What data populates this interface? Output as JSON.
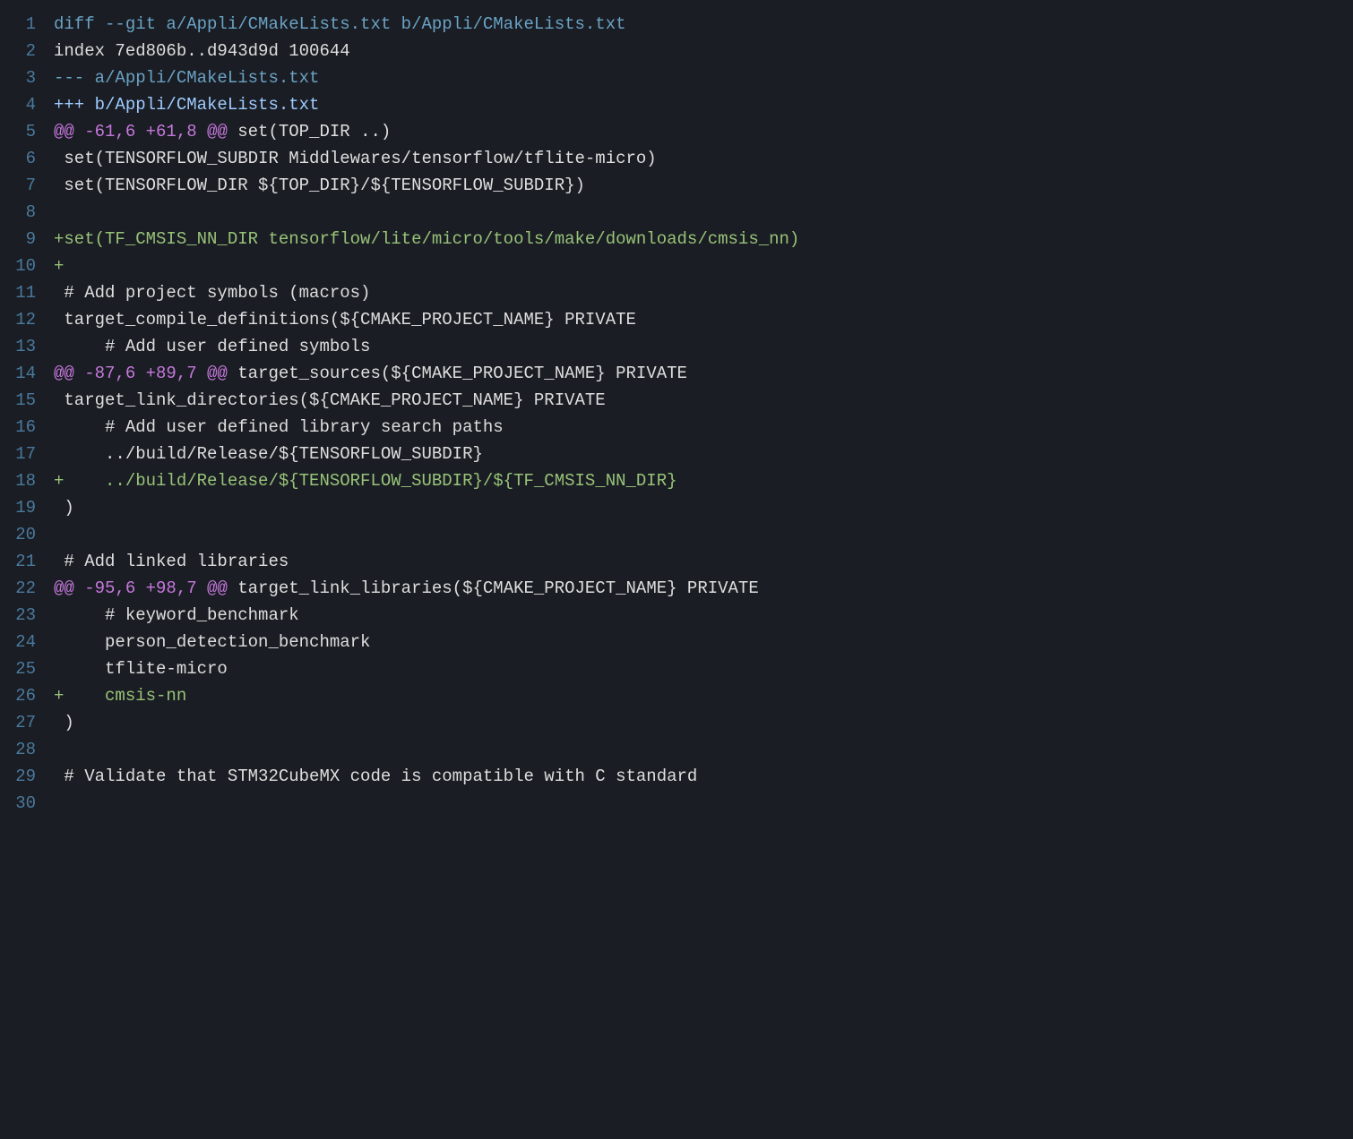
{
  "lines": [
    {
      "num": "1",
      "segments": [
        {
          "cls": "tok-diff-header",
          "text": "diff --git a/Appli/CMakeLists.txt b/Appli/CMakeLists.txt"
        }
      ]
    },
    {
      "num": "2",
      "segments": [
        {
          "cls": "tok-default",
          "text": "index 7ed806b..d943d9d 100644"
        }
      ]
    },
    {
      "num": "3",
      "segments": [
        {
          "cls": "tok-diff-minus",
          "text": "--- a/Appli/CMakeLists.txt"
        }
      ]
    },
    {
      "num": "4",
      "segments": [
        {
          "cls": "tok-diff-plus",
          "text": "+++ b/Appli/CMakeLists.txt"
        }
      ]
    },
    {
      "num": "5",
      "segments": [
        {
          "cls": "tok-hunk",
          "text": "@@ -61,6 +61,8 @@"
        },
        {
          "cls": "tok-context",
          "text": " set(TOP_DIR ..)"
        }
      ]
    },
    {
      "num": "6",
      "segments": [
        {
          "cls": "tok-default",
          "text": " set(TENSORFLOW_SUBDIR Middlewares/tensorflow/tflite-micro)"
        }
      ]
    },
    {
      "num": "7",
      "segments": [
        {
          "cls": "tok-default",
          "text": " set(TENSORFLOW_DIR ${TOP_DIR}/${TENSORFLOW_SUBDIR})"
        }
      ]
    },
    {
      "num": "8",
      "segments": [
        {
          "cls": "tok-default",
          "text": ""
        }
      ]
    },
    {
      "num": "9",
      "segments": [
        {
          "cls": "tok-added",
          "text": "+set(TF_CMSIS_NN_DIR tensorflow/lite/micro/tools/make/downloads/cmsis_nn)"
        }
      ]
    },
    {
      "num": "10",
      "segments": [
        {
          "cls": "tok-added",
          "text": "+"
        }
      ]
    },
    {
      "num": "11",
      "segments": [
        {
          "cls": "tok-default",
          "text": " # Add project symbols (macros)"
        }
      ]
    },
    {
      "num": "12",
      "segments": [
        {
          "cls": "tok-default",
          "text": " target_compile_definitions(${CMAKE_PROJECT_NAME} PRIVATE"
        }
      ]
    },
    {
      "num": "13",
      "segments": [
        {
          "cls": "tok-default",
          "text": "     # Add user defined symbols"
        }
      ]
    },
    {
      "num": "14",
      "segments": [
        {
          "cls": "tok-hunk",
          "text": "@@ -87,6 +89,7 @@"
        },
        {
          "cls": "tok-context",
          "text": " target_sources(${CMAKE_PROJECT_NAME} PRIVATE"
        }
      ]
    },
    {
      "num": "15",
      "segments": [
        {
          "cls": "tok-default",
          "text": " target_link_directories(${CMAKE_PROJECT_NAME} PRIVATE"
        }
      ]
    },
    {
      "num": "16",
      "segments": [
        {
          "cls": "tok-default",
          "text": "     # Add user defined library search paths"
        }
      ]
    },
    {
      "num": "17",
      "segments": [
        {
          "cls": "tok-default",
          "text": "     ../build/Release/${TENSORFLOW_SUBDIR}"
        }
      ]
    },
    {
      "num": "18",
      "segments": [
        {
          "cls": "tok-added",
          "text": "+    ../build/Release/${TENSORFLOW_SUBDIR}/${TF_CMSIS_NN_DIR}"
        }
      ]
    },
    {
      "num": "19",
      "segments": [
        {
          "cls": "tok-default",
          "text": " )"
        }
      ]
    },
    {
      "num": "20",
      "segments": [
        {
          "cls": "tok-default",
          "text": ""
        }
      ]
    },
    {
      "num": "21",
      "segments": [
        {
          "cls": "tok-default",
          "text": " # Add linked libraries"
        }
      ]
    },
    {
      "num": "22",
      "segments": [
        {
          "cls": "tok-hunk",
          "text": "@@ -95,6 +98,7 @@"
        },
        {
          "cls": "tok-context",
          "text": " target_link_libraries(${CMAKE_PROJECT_NAME} PRIVATE"
        }
      ]
    },
    {
      "num": "23",
      "segments": [
        {
          "cls": "tok-default",
          "text": "     # keyword_benchmark"
        }
      ]
    },
    {
      "num": "24",
      "segments": [
        {
          "cls": "tok-default",
          "text": "     person_detection_benchmark"
        }
      ]
    },
    {
      "num": "25",
      "segments": [
        {
          "cls": "tok-default",
          "text": "     tflite-micro"
        }
      ]
    },
    {
      "num": "26",
      "segments": [
        {
          "cls": "tok-added",
          "text": "+    cmsis-nn"
        }
      ]
    },
    {
      "num": "27",
      "segments": [
        {
          "cls": "tok-default",
          "text": " )"
        }
      ]
    },
    {
      "num": "28",
      "segments": [
        {
          "cls": "tok-default",
          "text": ""
        }
      ]
    },
    {
      "num": "29",
      "segments": [
        {
          "cls": "tok-default",
          "text": " # Validate that STM32CubeMX code is compatible with C standard"
        }
      ]
    },
    {
      "num": "30",
      "segments": [
        {
          "cls": "tok-default",
          "text": ""
        }
      ]
    }
  ]
}
